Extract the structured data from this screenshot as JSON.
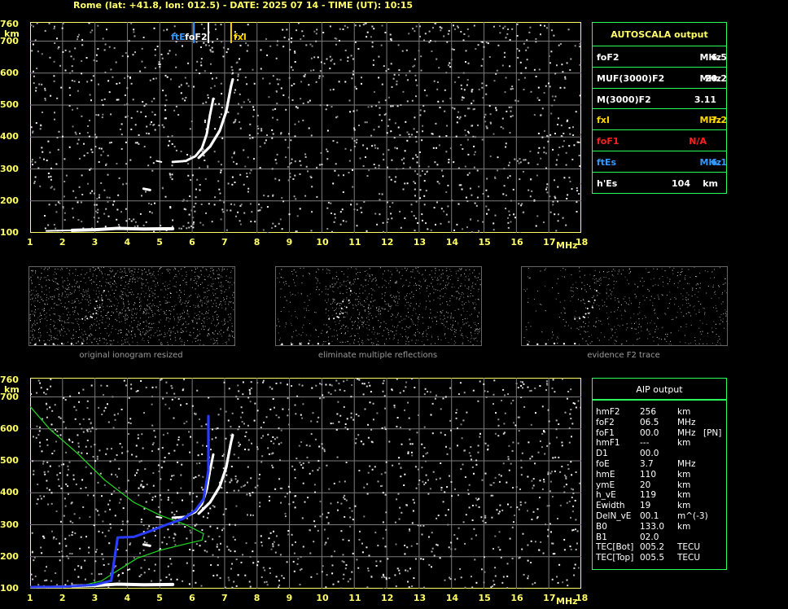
{
  "header": {
    "title": "Rome (lat: +41.8, lon: 012.5) - DATE: 2025 07 14 - TIME (UT): 10:15"
  },
  "axes": {
    "y_ticks": [
      "100",
      "200",
      "300",
      "400",
      "500",
      "600",
      "700",
      "760"
    ],
    "y_unit": "km",
    "x_ticks": [
      "1",
      "2",
      "3",
      "4",
      "5",
      "6",
      "7",
      "8",
      "9",
      "10",
      "11",
      "12",
      "13",
      "14",
      "15",
      "16",
      "17",
      "18"
    ],
    "x_unit": "MHz"
  },
  "markers": {
    "ftE": "ftE",
    "foF2": "foF2",
    "fxI": "fxI"
  },
  "autoscala": {
    "title": "AUTOSCALA output",
    "rows": [
      {
        "name": "foF2",
        "value": "6.5",
        "unit": "MHz",
        "color": "#ffffff"
      },
      {
        "name": "MUF(3000)F2",
        "value": "20.2",
        "unit": "MHz",
        "color": "#ffffff"
      },
      {
        "name": "M(3000)F2",
        "value": "3.11",
        "unit": "",
        "color": "#ffffff"
      },
      {
        "name": "fxI",
        "value": "7.2",
        "unit": "MHz",
        "color": "#ffd700"
      },
      {
        "name": "foF1",
        "value": "N/A",
        "unit": "",
        "color": "#ff2020"
      },
      {
        "name": "ftEs",
        "value": "6.1",
        "unit": "MHz",
        "color": "#3399ff"
      },
      {
        "name": "h'Es",
        "value": "104",
        "unit": "km",
        "color": "#ffffff"
      }
    ]
  },
  "thumbnails": [
    {
      "caption": "original ionogram resized"
    },
    {
      "caption": "eliminate multiple reflections"
    },
    {
      "caption": "evidence F2 trace"
    }
  ],
  "aip": {
    "title": "AIP output",
    "rows": [
      {
        "name": "hmF2",
        "value": "256",
        "unit": "km",
        "note": ""
      },
      {
        "name": "foF2",
        "value": "06.5",
        "unit": "MHz",
        "note": ""
      },
      {
        "name": "foF1",
        "value": "00.0",
        "unit": "MHz",
        "note": "[PN]"
      },
      {
        "name": "hmF1",
        "value": "---",
        "unit": "km",
        "note": ""
      },
      {
        "name": "D1",
        "value": "00.0",
        "unit": "",
        "note": ""
      },
      {
        "name": "foE",
        "value": "3.7",
        "unit": "MHz",
        "note": ""
      },
      {
        "name": "hmE",
        "value": "110",
        "unit": "km",
        "note": ""
      },
      {
        "name": "ymE",
        "value": "20",
        "unit": "km",
        "note": ""
      },
      {
        "name": "h_vE",
        "value": "119",
        "unit": "km",
        "note": ""
      },
      {
        "name": "Ewidth",
        "value": "19",
        "unit": "km",
        "note": ""
      },
      {
        "name": "DelN_vE",
        "value": "00.1",
        "unit": "m^(-3)",
        "note": ""
      },
      {
        "name": "B0",
        "value": "133.0",
        "unit": "km",
        "note": ""
      },
      {
        "name": "B1",
        "value": "02.0",
        "unit": "",
        "note": ""
      },
      {
        "name": "TEC[Bot]",
        "value": "005.2",
        "unit": "TECU",
        "note": ""
      },
      {
        "name": "TEC[Top]",
        "value": "005.5",
        "unit": "TECU",
        "note": ""
      }
    ]
  }
}
